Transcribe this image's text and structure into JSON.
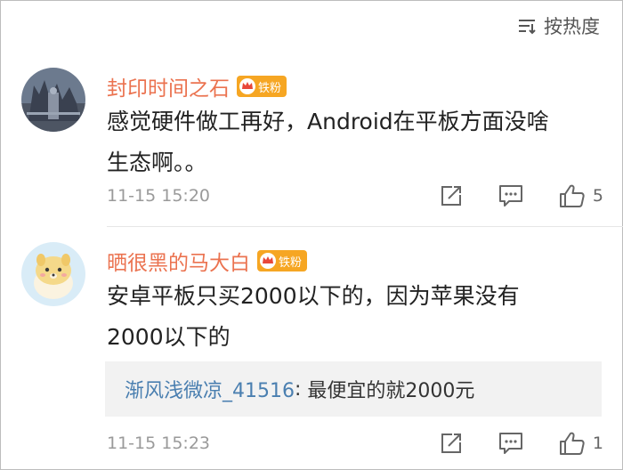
{
  "sort": {
    "label": "按热度"
  },
  "comments": [
    {
      "username": "封印时间之石",
      "badge": "铁粉",
      "text_line1": "感觉硬件做工再好，Android在平板方面没啥",
      "text_line2": "生态啊。。",
      "time": "11-15 15:20",
      "likes": "5"
    },
    {
      "username": "晒很黑的马大白",
      "badge": "铁粉",
      "text_line1": "安卓平板只买2000以下的，因为苹果没有",
      "text_line2": "2000以下的",
      "reply": {
        "username": "渐风浅微凉_41516",
        "separator": ": ",
        "text": "最便宜的就2000元"
      },
      "time": "11-15 15:23",
      "likes": "1"
    }
  ]
}
